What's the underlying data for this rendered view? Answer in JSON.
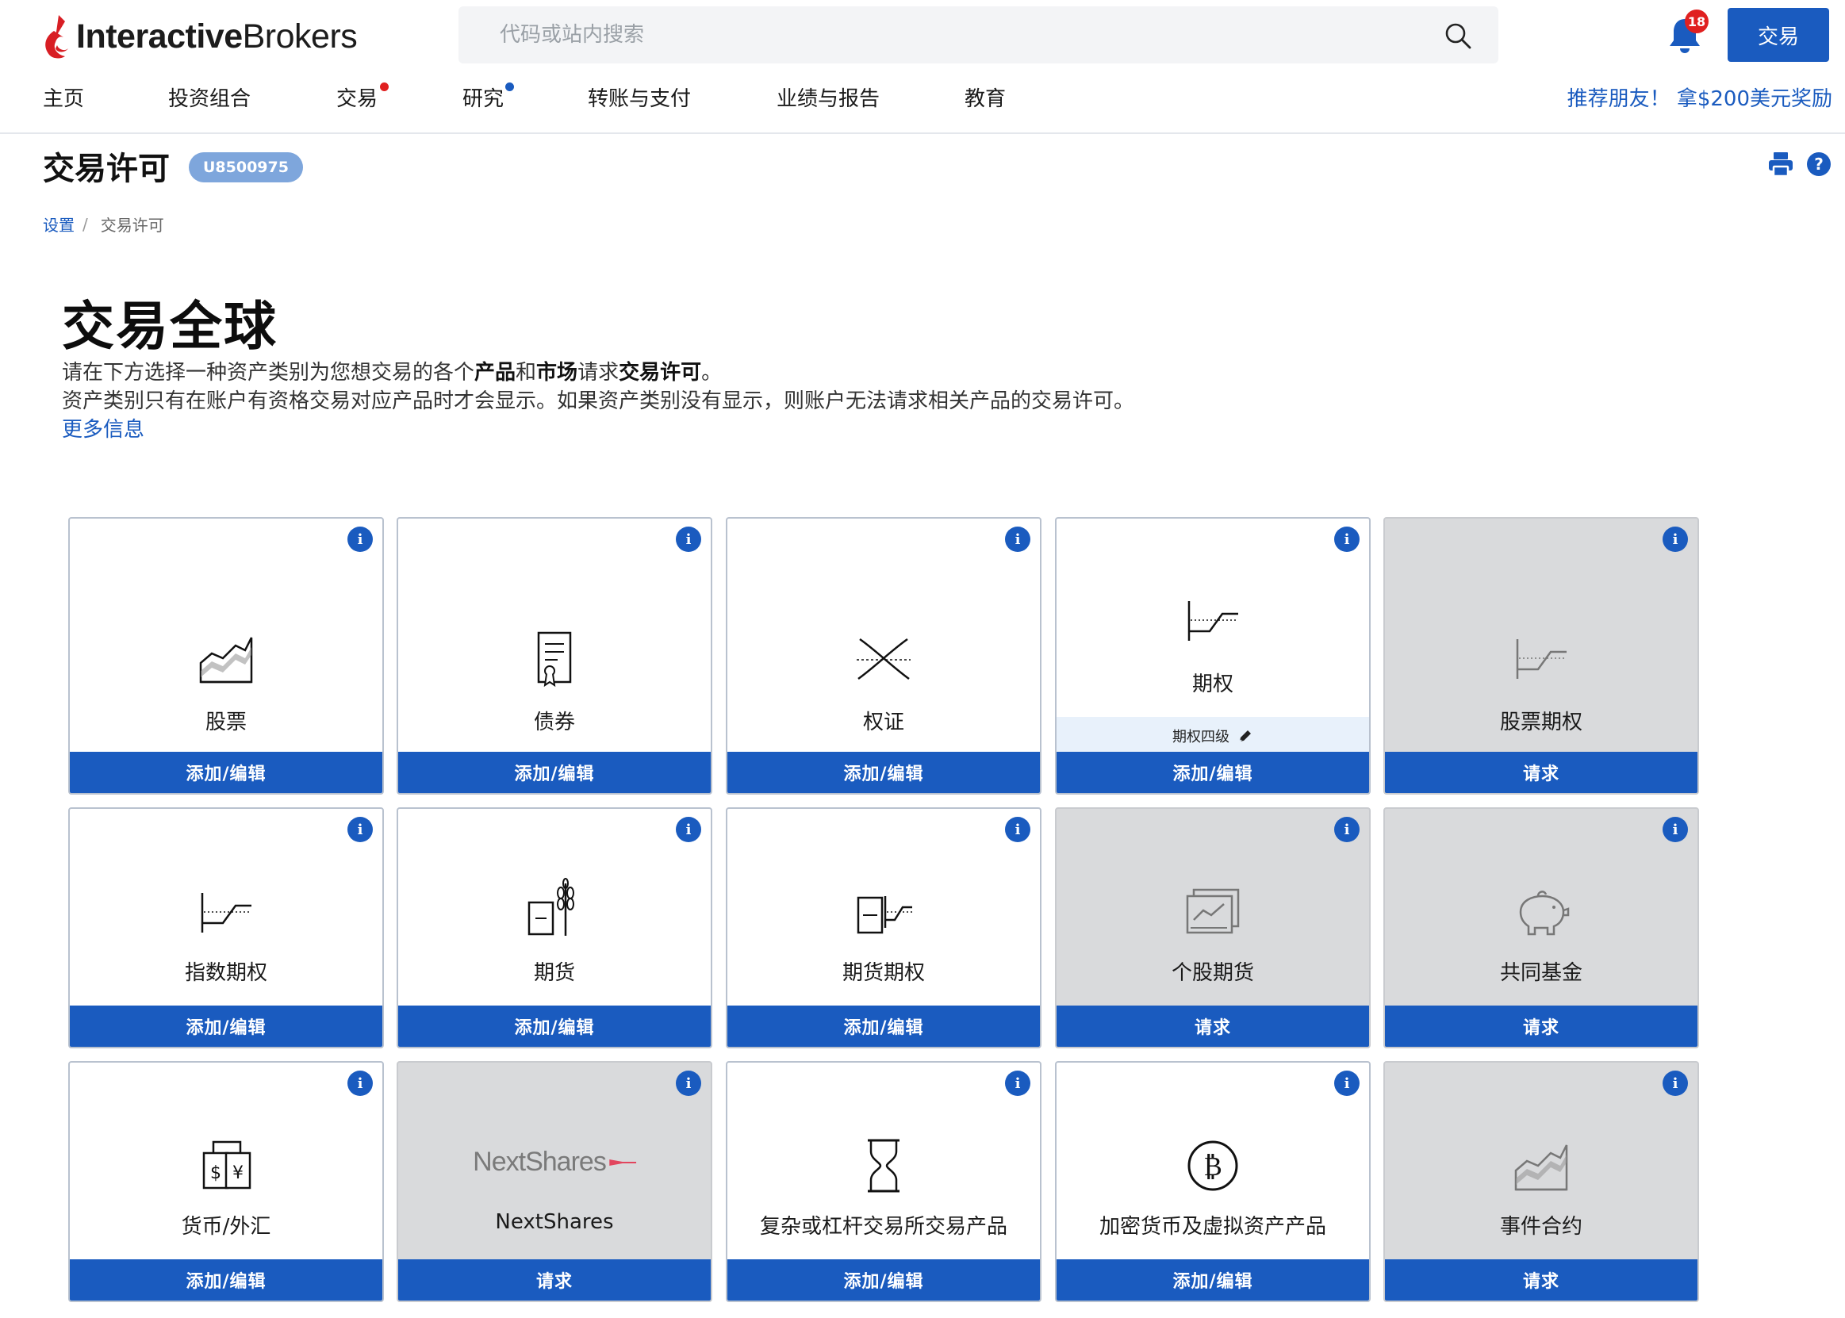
{
  "header": {
    "logo": {
      "bold": "Interactive",
      "regular": "Brokers"
    },
    "search": {
      "placeholder": "代码或站内搜索"
    },
    "notifications": {
      "count": "18"
    },
    "trade_button": "交易",
    "nav": [
      {
        "label": "主页",
        "dot": null
      },
      {
        "label": "投资组合",
        "dot": null
      },
      {
        "label": "交易",
        "dot": "#e02020"
      },
      {
        "label": "研究",
        "dot": "#1a5bbf"
      },
      {
        "label": "转账与支付",
        "dot": null
      },
      {
        "label": "业绩与报告",
        "dot": null
      },
      {
        "label": "教育",
        "dot": null
      }
    ],
    "referral": "推荐朋友！ 拿$200美元奖励"
  },
  "page": {
    "title": "交易许可",
    "account_id": "U8500975",
    "breadcrumb": {
      "parent": "设置",
      "separator": "/",
      "current": "交易许可"
    }
  },
  "intro": {
    "heading": "交易全球",
    "line1_a": "请在下方选择一种资产类别为您想交易的各个",
    "line1_b": "产品",
    "line1_c": "和",
    "line1_d": "市场",
    "line1_e": "请求",
    "line1_f": "交易许可",
    "line1_g": "。",
    "line2": "资产类别只有在账户有资格交易对应产品时才会显示。如果资产类别没有显示，则账户无法请求相关产品的交易许可。",
    "more_link": "更多信息"
  },
  "tiles": [
    {
      "label": "股票",
      "icon": "stock-chart-icon",
      "action": "添加/编辑",
      "disabled": false
    },
    {
      "label": "债券",
      "icon": "bond-certificate-icon",
      "action": "添加/编辑",
      "disabled": false
    },
    {
      "label": "权证",
      "icon": "warrant-cross-icon",
      "action": "添加/编辑",
      "disabled": false
    },
    {
      "label": "期权",
      "icon": "option-payoff-icon",
      "action": "添加/编辑",
      "disabled": false,
      "sublevel": "期权四级"
    },
    {
      "label": "股票期权",
      "icon": "option-payoff-icon",
      "action": "请求",
      "disabled": true
    },
    {
      "label": "指数期权",
      "icon": "option-payoff-icon",
      "action": "添加/编辑",
      "disabled": false
    },
    {
      "label": "期货",
      "icon": "wheat-futures-icon",
      "action": "添加/编辑",
      "disabled": false
    },
    {
      "label": "期货期权",
      "icon": "futures-option-icon",
      "action": "添加/编辑",
      "disabled": false
    },
    {
      "label": "个股期货",
      "icon": "stock-futures-icon",
      "action": "请求",
      "disabled": true
    },
    {
      "label": "共同基金",
      "icon": "piggy-bank-icon",
      "action": "请求",
      "disabled": true
    },
    {
      "label": "货币/外汇",
      "icon": "currency-exchange-icon",
      "action": "添加/编辑",
      "disabled": false
    },
    {
      "label": "NextShares",
      "icon": "nextshares-logo",
      "logo_text": "NextShares",
      "action": "请求",
      "disabled": true
    },
    {
      "label": "复杂或杠杆交易所交易产品",
      "icon": "hourglass-icon",
      "action": "添加/编辑",
      "disabled": false
    },
    {
      "label": "加密货币及虚拟资产产品",
      "icon": "bitcoin-icon",
      "action": "添加/编辑",
      "disabled": false
    },
    {
      "label": "事件合约",
      "icon": "stock-chart-icon",
      "action": "请求",
      "disabled": true
    }
  ],
  "colors": {
    "primary": "#1a5bbf",
    "badge": "#7ea6dc",
    "disabled_tile": "#d9dadc",
    "notification": "#e02020"
  }
}
